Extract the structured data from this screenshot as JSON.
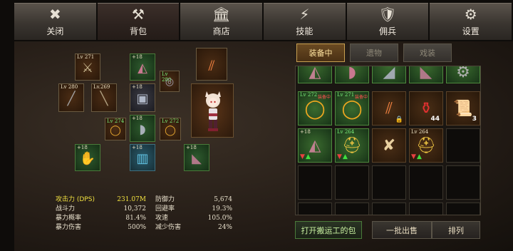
{
  "nav": [
    {
      "label": "关闭",
      "icon": "✖"
    },
    {
      "label": "背包",
      "icon": "⚒"
    },
    {
      "label": "商店",
      "icon": "🏛"
    },
    {
      "label": "技能",
      "icon": "⚡"
    },
    {
      "label": "佣兵",
      "icon": "🛡"
    },
    {
      "label": "设置",
      "icon": "⚙"
    }
  ],
  "equipment": [
    {
      "level": "Lv 271",
      "icon": "crossed-daggers"
    },
    {
      "level": "+18",
      "icon": "helmet"
    },
    {
      "level": "Lv 280",
      "icon": "ring"
    },
    {
      "level": "",
      "icon": "claw-slash"
    },
    {
      "level": "Lv 280",
      "icon": "gun"
    },
    {
      "level": "Lv.269",
      "icon": "spear"
    },
    {
      "level": "+18",
      "icon": "chest-armor"
    },
    {
      "level": "Lv 274",
      "icon": "ring"
    },
    {
      "level": "+18",
      "icon": "bracer"
    },
    {
      "level": "Lv 272",
      "icon": "ring"
    },
    {
      "level": "+18",
      "icon": "gauntlet"
    },
    {
      "level": "+18",
      "icon": "leg-armor"
    },
    {
      "level": "+18",
      "icon": "boots"
    }
  ],
  "character": {
    "icon": "chibi-cat-girl"
  },
  "stats": {
    "left": [
      {
        "label": "攻击力 (DPS)",
        "value": "231.07M",
        "highlight": true
      },
      {
        "label": "战斗力",
        "value": "10,372"
      },
      {
        "label": "暴力概率",
        "value": "81.4%"
      },
      {
        "label": "暴力伤害",
        "value": "500%"
      }
    ],
    "right": [
      {
        "label": "防御力",
        "value": "5,674"
      },
      {
        "label": "回避率",
        "value": "19.3%"
      },
      {
        "label": "攻速",
        "value": "105.0%"
      },
      {
        "label": "减少伤害",
        "value": "24%"
      }
    ]
  },
  "tabs": [
    {
      "label": "装备中",
      "active": true
    },
    {
      "label": "遗物",
      "active": false
    },
    {
      "label": "戏装",
      "active": false
    }
  ],
  "inventory": [
    {
      "icon": "helmet",
      "count": "",
      "level": "",
      "tag": ""
    },
    {
      "icon": "bracer",
      "count": "",
      "level": "",
      "tag": ""
    },
    {
      "icon": "shoulder",
      "count": "",
      "level": "",
      "tag": ""
    },
    {
      "icon": "boots",
      "count": "",
      "level": "",
      "tag": ""
    },
    {
      "icon": "gear",
      "count": "",
      "level": "",
      "tag": ""
    },
    {
      "icon": "ring",
      "count": "",
      "level": "Lv 272",
      "tag": "装备中"
    },
    {
      "icon": "ring",
      "count": "",
      "level": "Lv 271",
      "tag": "装备中"
    },
    {
      "icon": "claw-slash",
      "count": "",
      "level": "",
      "tag": "locked"
    },
    {
      "icon": "potion",
      "count": "44",
      "level": "",
      "tag": ""
    },
    {
      "icon": "scroll",
      "count": "3",
      "level": "",
      "tag": ""
    },
    {
      "icon": "helmet",
      "count": "",
      "level": "+18",
      "tag": ""
    },
    {
      "icon": "gold-helm",
      "count": "",
      "level": "Lv 264",
      "tag": ""
    },
    {
      "icon": "map-scroll",
      "count": "",
      "level": "",
      "tag": ""
    },
    {
      "icon": "gold-helm",
      "count": "",
      "level": "Lv 264",
      "tag": ""
    }
  ],
  "buttons": {
    "open_carrier": "打开搬运工的包",
    "batch_sell": "一批出售",
    "sort": "排列"
  }
}
